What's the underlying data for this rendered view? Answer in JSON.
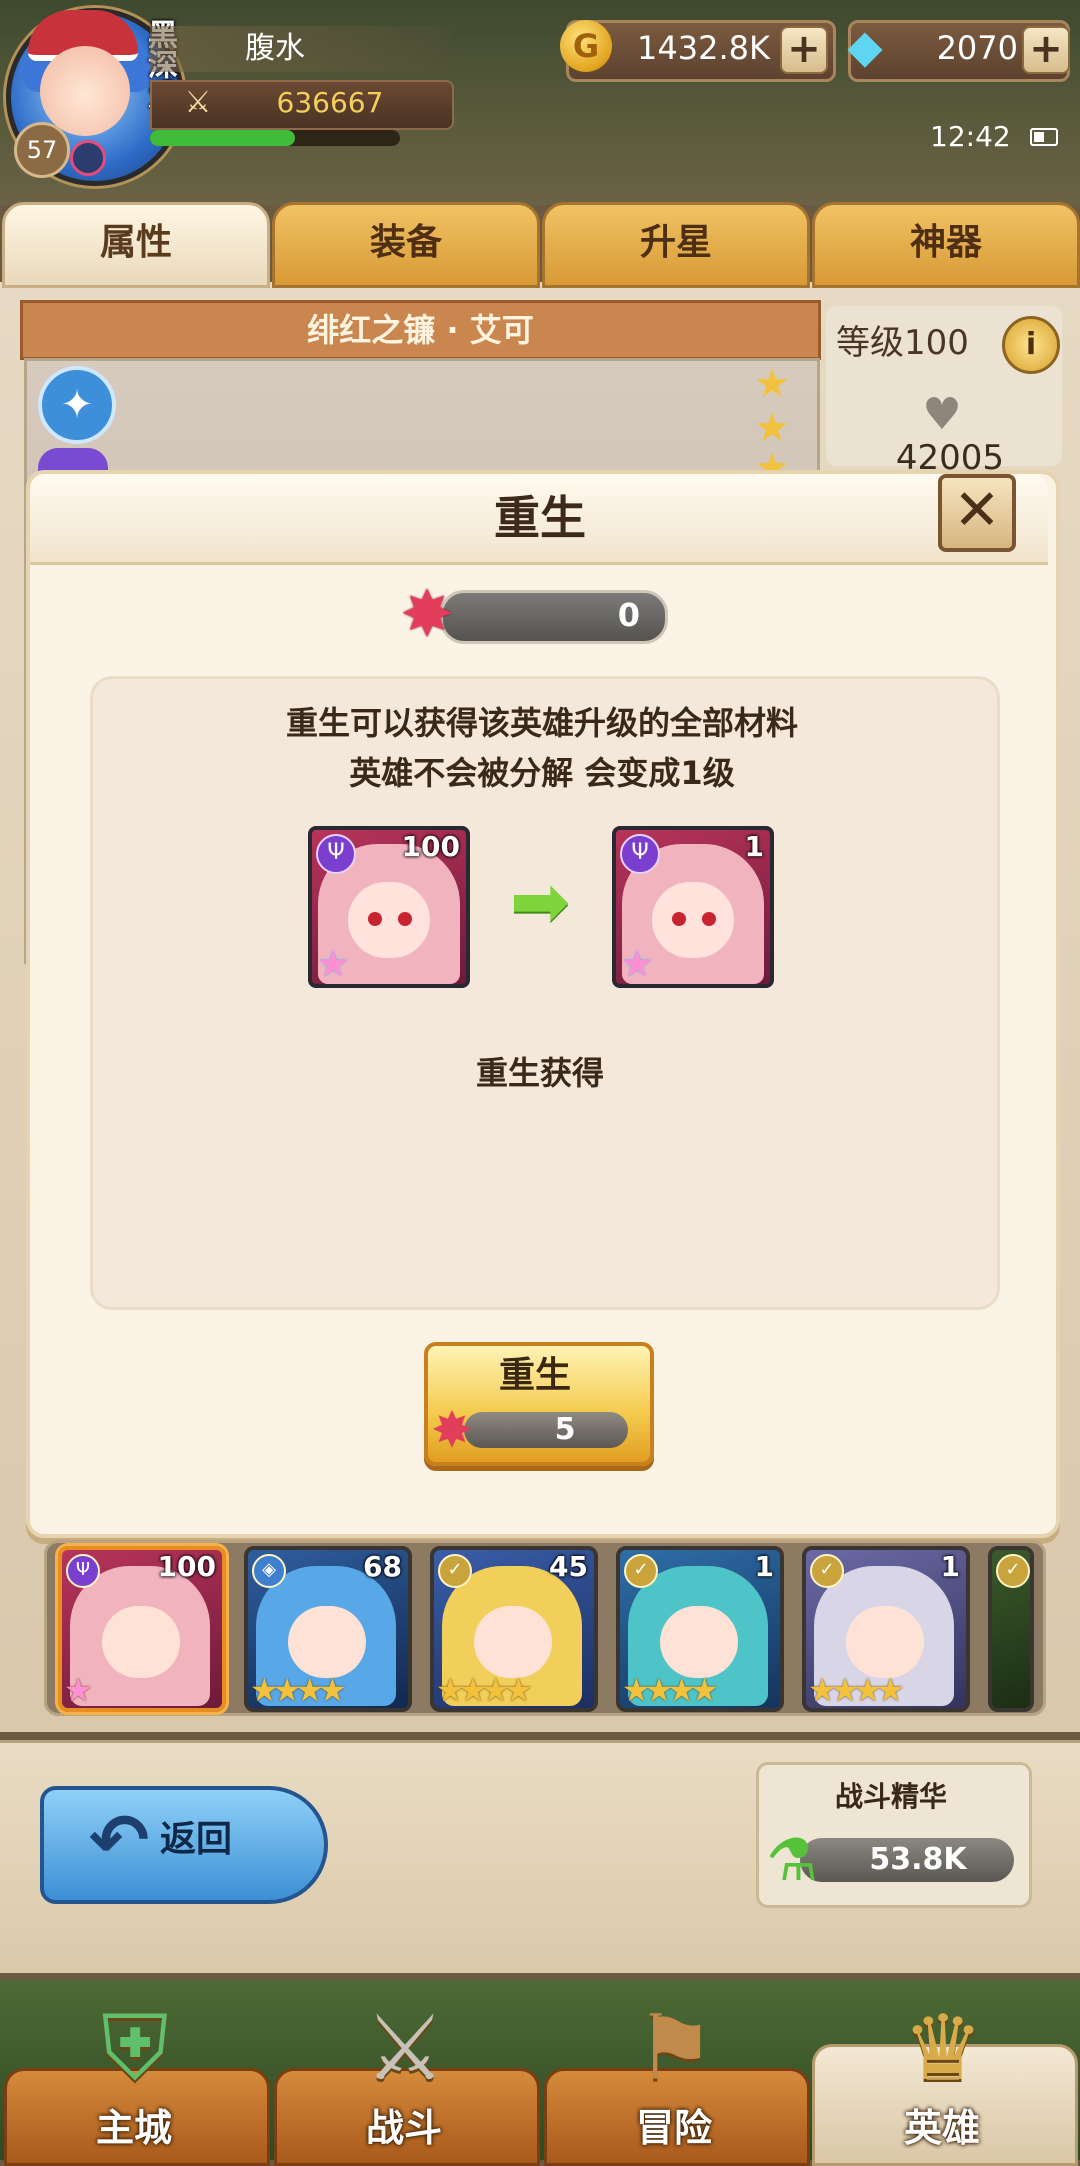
{
  "player": {
    "name": "腹水",
    "guild_tag": "黑深爱",
    "level": "57",
    "power": "636667",
    "exp_progress": 0.58
  },
  "resources": {
    "gold": "1432.8K",
    "gems": "2070"
  },
  "status": {
    "time": "12:42"
  },
  "tabs": [
    "属性",
    "装备",
    "升星",
    "神器"
  ],
  "hero_panel": {
    "hero_name": "绯红之镰 · 艾可",
    "level_label": "等级100",
    "hp_partial": "42005"
  },
  "modal": {
    "title": "重生",
    "currency_owned": "0",
    "desc_line1": "重生可以获得该英雄升级的全部材料",
    "desc_line2": "英雄不会被分解 会变成1级",
    "before_level": "100",
    "after_level": "1",
    "reward_label": "重生获得",
    "confirm_label": "重生",
    "cost": "5"
  },
  "roster": [
    {
      "level": "100",
      "stars": 0,
      "selected": true
    },
    {
      "level": "68",
      "stars": 4
    },
    {
      "level": "45",
      "stars": 4
    },
    {
      "level": "1",
      "stars": 4
    },
    {
      "level": "1",
      "stars": 4
    }
  ],
  "bottom": {
    "back_label": "返回",
    "essence_label": "战斗精华",
    "essence_value": "53.8K"
  },
  "nav": [
    "主城",
    "战斗",
    "冒险",
    "英雄"
  ],
  "colors": {
    "tab_gold": "#e0a640",
    "modal_bg": "#fbf3e6",
    "button_yellow": "#f4c94b",
    "back_blue": "#3c8fd5"
  }
}
